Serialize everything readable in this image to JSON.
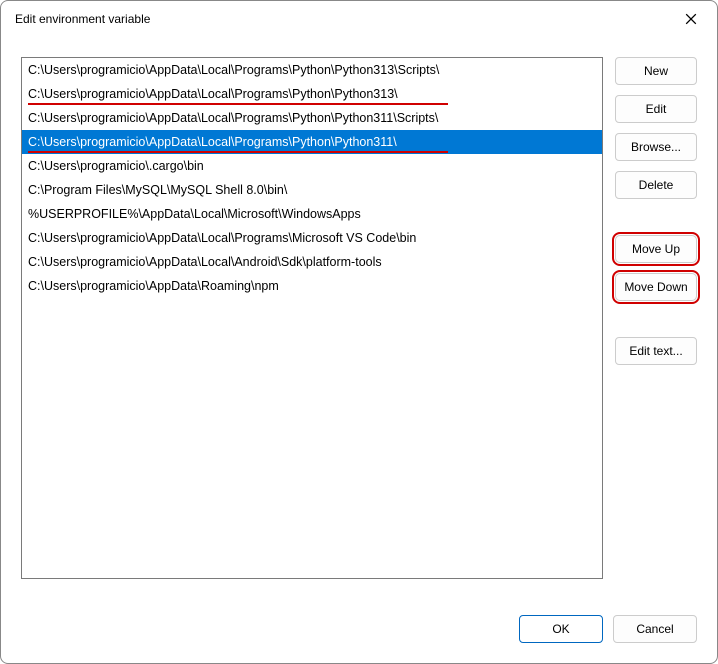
{
  "title": "Edit environment variable",
  "list_items": [
    {
      "text": "C:\\Users\\programicio\\AppData\\Local\\Programs\\Python\\Python313\\Scripts\\",
      "selected": false,
      "underline_width": 0
    },
    {
      "text": "C:\\Users\\programicio\\AppData\\Local\\Programs\\Python\\Python313\\",
      "selected": false,
      "underline_width": 420
    },
    {
      "text": "C:\\Users\\programicio\\AppData\\Local\\Programs\\Python\\Python311\\Scripts\\",
      "selected": false,
      "underline_width": 0
    },
    {
      "text": "C:\\Users\\programicio\\AppData\\Local\\Programs\\Python\\Python311\\",
      "selected": true,
      "underline_width": 420
    },
    {
      "text": "C:\\Users\\programicio\\.cargo\\bin",
      "selected": false,
      "underline_width": 0
    },
    {
      "text": "C:\\Program Files\\MySQL\\MySQL Shell 8.0\\bin\\",
      "selected": false,
      "underline_width": 0
    },
    {
      "text": "%USERPROFILE%\\AppData\\Local\\Microsoft\\WindowsApps",
      "selected": false,
      "underline_width": 0
    },
    {
      "text": "C:\\Users\\programicio\\AppData\\Local\\Programs\\Microsoft VS Code\\bin",
      "selected": false,
      "underline_width": 0
    },
    {
      "text": "C:\\Users\\programicio\\AppData\\Local\\Android\\Sdk\\platform-tools",
      "selected": false,
      "underline_width": 0
    },
    {
      "text": "C:\\Users\\programicio\\AppData\\Roaming\\npm",
      "selected": false,
      "underline_width": 0
    }
  ],
  "buttons": {
    "new": "New",
    "edit": "Edit",
    "browse": "Browse...",
    "delete": "Delete",
    "move_up": "Move Up",
    "move_down": "Move Down",
    "edit_text": "Edit text...",
    "ok": "OK",
    "cancel": "Cancel"
  },
  "highlight_color": "#d00000",
  "selection_color": "#0078d4"
}
